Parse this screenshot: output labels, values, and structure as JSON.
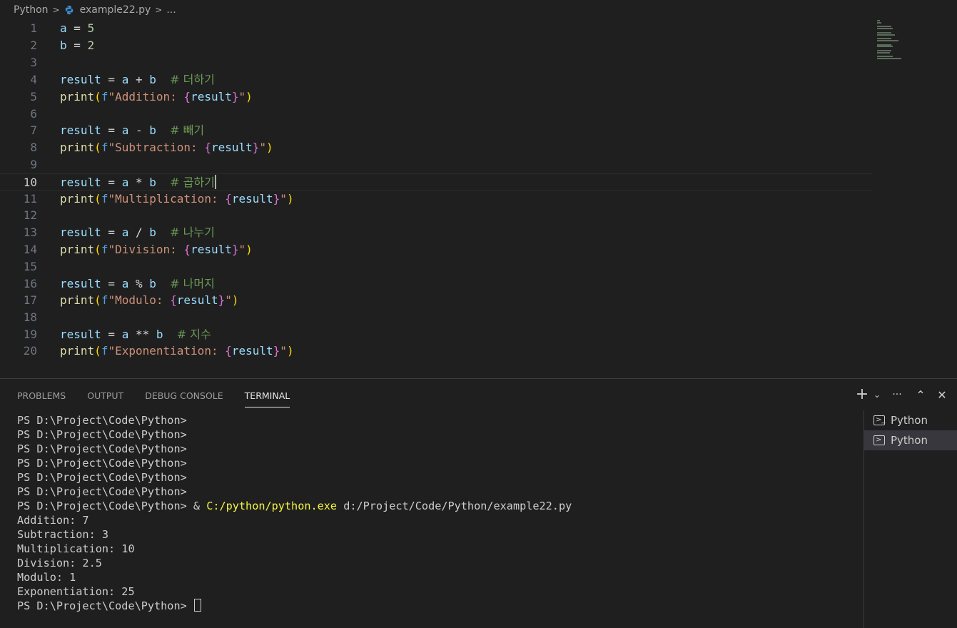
{
  "breadcrumb": {
    "items": [
      "Python",
      "example22.py",
      "..."
    ],
    "separator": ">",
    "file_icon": "python-icon"
  },
  "editor": {
    "current_line": 10,
    "lines": [
      {
        "n": "1",
        "tokens": [
          [
            "var",
            "a"
          ],
          [
            "op",
            " = "
          ],
          [
            "num",
            "5"
          ]
        ]
      },
      {
        "n": "2",
        "tokens": [
          [
            "var",
            "b"
          ],
          [
            "op",
            " = "
          ],
          [
            "num",
            "2"
          ]
        ]
      },
      {
        "n": "3",
        "tokens": []
      },
      {
        "n": "4",
        "tokens": [
          [
            "var",
            "result"
          ],
          [
            "op",
            " = "
          ],
          [
            "var",
            "a"
          ],
          [
            "op",
            " + "
          ],
          [
            "var",
            "b"
          ],
          [
            "op",
            "  "
          ],
          [
            "cmt",
            "# 더하기"
          ]
        ]
      },
      {
        "n": "5",
        "tokens": [
          [
            "fn",
            "print"
          ],
          [
            "p1",
            "("
          ],
          [
            "fpre",
            "f"
          ],
          [
            "str",
            "\"Addition: "
          ],
          [
            "p2",
            "{"
          ],
          [
            "var",
            "result"
          ],
          [
            "p2",
            "}"
          ],
          [
            "str",
            "\""
          ],
          [
            "p1",
            ")"
          ]
        ]
      },
      {
        "n": "6",
        "tokens": []
      },
      {
        "n": "7",
        "tokens": [
          [
            "var",
            "result"
          ],
          [
            "op",
            " = "
          ],
          [
            "var",
            "a"
          ],
          [
            "op",
            " - "
          ],
          [
            "var",
            "b"
          ],
          [
            "op",
            "  "
          ],
          [
            "cmt",
            "# 빼기"
          ]
        ]
      },
      {
        "n": "8",
        "tokens": [
          [
            "fn",
            "print"
          ],
          [
            "p1",
            "("
          ],
          [
            "fpre",
            "f"
          ],
          [
            "str",
            "\"Subtraction: "
          ],
          [
            "p2",
            "{"
          ],
          [
            "var",
            "result"
          ],
          [
            "p2",
            "}"
          ],
          [
            "str",
            "\""
          ],
          [
            "p1",
            ")"
          ]
        ]
      },
      {
        "n": "9",
        "tokens": []
      },
      {
        "n": "10",
        "tokens": [
          [
            "var",
            "result"
          ],
          [
            "op",
            " = "
          ],
          [
            "var",
            "a"
          ],
          [
            "op",
            " * "
          ],
          [
            "var",
            "b"
          ],
          [
            "op",
            "  "
          ],
          [
            "cmt",
            "# 곱하기"
          ]
        ]
      },
      {
        "n": "11",
        "tokens": [
          [
            "fn",
            "print"
          ],
          [
            "p1",
            "("
          ],
          [
            "fpre",
            "f"
          ],
          [
            "str",
            "\"Multiplication: "
          ],
          [
            "p2",
            "{"
          ],
          [
            "var",
            "result"
          ],
          [
            "p2",
            "}"
          ],
          [
            "str",
            "\""
          ],
          [
            "p1",
            ")"
          ]
        ]
      },
      {
        "n": "12",
        "tokens": []
      },
      {
        "n": "13",
        "tokens": [
          [
            "var",
            "result"
          ],
          [
            "op",
            " = "
          ],
          [
            "var",
            "a"
          ],
          [
            "op",
            " / "
          ],
          [
            "var",
            "b"
          ],
          [
            "op",
            "  "
          ],
          [
            "cmt",
            "# 나누기"
          ]
        ]
      },
      {
        "n": "14",
        "tokens": [
          [
            "fn",
            "print"
          ],
          [
            "p1",
            "("
          ],
          [
            "fpre",
            "f"
          ],
          [
            "str",
            "\"Division: "
          ],
          [
            "p2",
            "{"
          ],
          [
            "var",
            "result"
          ],
          [
            "p2",
            "}"
          ],
          [
            "str",
            "\""
          ],
          [
            "p1",
            ")"
          ]
        ]
      },
      {
        "n": "15",
        "tokens": []
      },
      {
        "n": "16",
        "tokens": [
          [
            "var",
            "result"
          ],
          [
            "op",
            " = "
          ],
          [
            "var",
            "a"
          ],
          [
            "op",
            " % "
          ],
          [
            "var",
            "b"
          ],
          [
            "op",
            "  "
          ],
          [
            "cmt",
            "# 나머지"
          ]
        ]
      },
      {
        "n": "17",
        "tokens": [
          [
            "fn",
            "print"
          ],
          [
            "p1",
            "("
          ],
          [
            "fpre",
            "f"
          ],
          [
            "str",
            "\"Modulo: "
          ],
          [
            "p2",
            "{"
          ],
          [
            "var",
            "result"
          ],
          [
            "p2",
            "}"
          ],
          [
            "str",
            "\""
          ],
          [
            "p1",
            ")"
          ]
        ]
      },
      {
        "n": "18",
        "tokens": []
      },
      {
        "n": "19",
        "tokens": [
          [
            "var",
            "result"
          ],
          [
            "op",
            " = "
          ],
          [
            "var",
            "a"
          ],
          [
            "op",
            " ** "
          ],
          [
            "var",
            "b"
          ],
          [
            "op",
            "  "
          ],
          [
            "cmt",
            "# 지수"
          ]
        ]
      },
      {
        "n": "20",
        "tokens": [
          [
            "fn",
            "print"
          ],
          [
            "p1",
            "("
          ],
          [
            "fpre",
            "f"
          ],
          [
            "str",
            "\"Exponentiation: "
          ],
          [
            "p2",
            "{"
          ],
          [
            "var",
            "result"
          ],
          [
            "p2",
            "}"
          ],
          [
            "str",
            "\""
          ],
          [
            "p1",
            ")"
          ]
        ]
      }
    ]
  },
  "panel": {
    "tabs": [
      {
        "label": "PROBLEMS",
        "active": false
      },
      {
        "label": "OUTPUT",
        "active": false
      },
      {
        "label": "DEBUG CONSOLE",
        "active": false
      },
      {
        "label": "TERMINAL",
        "active": true
      }
    ],
    "actions": {
      "new_terminal": "+",
      "dropdown": "⌄",
      "more": "···",
      "maximize": "⌃",
      "close": "✕"
    }
  },
  "terminal": {
    "prompt": "PS D:\\Project\\Code\\Python>",
    "command_prefix": " & ",
    "command_exe": "C:/python/python.exe",
    "command_arg": " d:/Project/Code/Python/example22.py",
    "empty_prompts_count_label": "6",
    "output": [
      "Addition: 7",
      "Subtraction: 3",
      "Multiplication: 10",
      "Division: 2.5",
      "Modulo: 1",
      "Exponentiation: 25"
    ],
    "final_prompt": "PS D:\\Project\\Code\\Python> "
  },
  "terminal_list": {
    "items": [
      {
        "label": "Python",
        "selected": false,
        "icon": "terminal-powershell-icon"
      },
      {
        "label": "Python",
        "selected": true,
        "icon": "terminal-icon"
      }
    ]
  }
}
